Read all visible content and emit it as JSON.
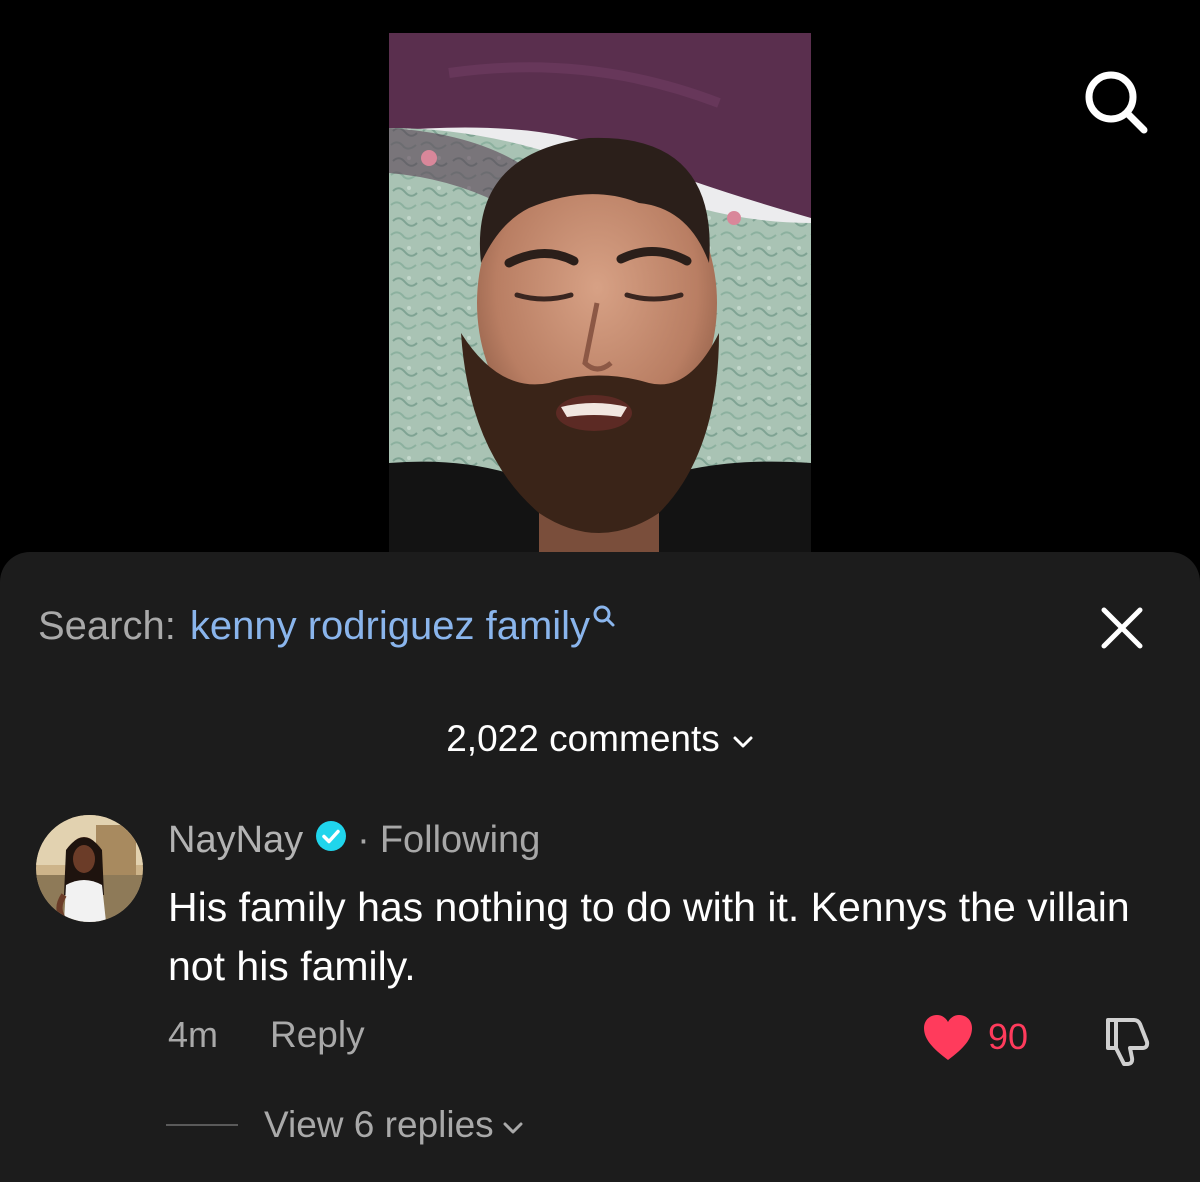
{
  "search": {
    "prefix": "Search:",
    "query": "kenny rodriguez family"
  },
  "comments": {
    "count_label": "2,022 comments"
  },
  "comment": {
    "username": "NayNay",
    "separator": "·",
    "relation": "Following",
    "text": "His family has nothing to do with it. Kennys the villain not his family.",
    "time": "4m",
    "reply_label": "Reply",
    "likes": "90",
    "view_replies_label": "View 6 replies"
  },
  "icons": {
    "top_search": "search-icon",
    "close": "close-icon",
    "query_search": "search-icon",
    "verified": "verified-badge-icon",
    "like": "heart-icon",
    "dislike": "thumbs-down-icon",
    "chevron": "chevron-down-icon"
  },
  "colors": {
    "background": "#000000",
    "sheet": "#1c1c1c",
    "link_blue": "#8ab5ec",
    "like_red": "#ff3b5c",
    "verified_cyan": "#20d5ec",
    "muted_text": "#a9a9a9"
  }
}
